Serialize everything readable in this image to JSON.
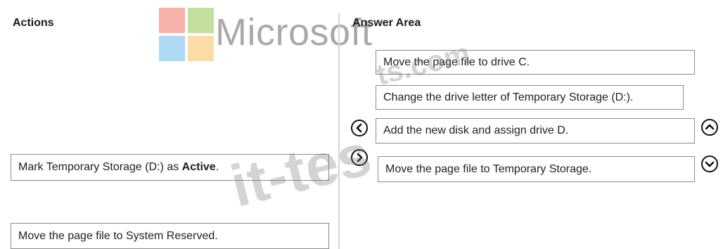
{
  "actions_panel": {
    "title": "Actions",
    "items": [
      {
        "text": "Mark Temporary Storage (D:) as ",
        "bold": "Active",
        "suffix": "."
      },
      {
        "text": "Move the page file to System Reserved."
      }
    ]
  },
  "answer_panel": {
    "title": "Answer Area",
    "items": [
      {
        "text": "Move the page file to drive C."
      },
      {
        "text": "Change the drive letter of Temporary Storage (D:)."
      },
      {
        "text": "Add the new disk and assign drive D."
      },
      {
        "text": "Move the page file to Temporary Storage."
      }
    ]
  },
  "controls": {
    "move_left_icon": "chevron-left",
    "move_right_icon": "chevron-right",
    "move_up_icon": "chevron-up",
    "move_down_icon": "chevron-down"
  },
  "watermarks": {
    "logo_text": "Microsoft",
    "logo_colors": [
      "#f25022",
      "#7fba00",
      "#00a4ef",
      "#ffb900"
    ],
    "site_text": "it-tests.com"
  }
}
